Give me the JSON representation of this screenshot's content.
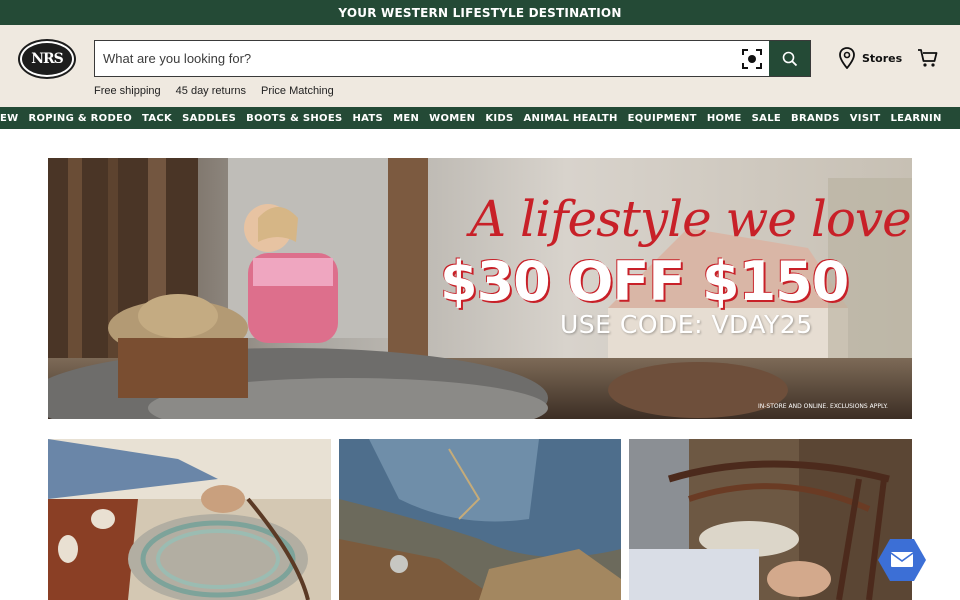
{
  "announcement": "YOUR WESTERN LIFESTYLE DESTINATION",
  "logo": {
    "text": "NRS"
  },
  "search": {
    "placeholder": "What are you looking for?"
  },
  "header": {
    "stores_label": "Stores"
  },
  "perks": [
    "Free shipping",
    "45 day returns",
    "Price Matching"
  ],
  "nav": [
    "EW",
    "ROPING & RODEO",
    "TACK",
    "SADDLES",
    "BOOTS & SHOES",
    "HATS",
    "MEN",
    "WOMEN",
    "KIDS",
    "ANIMAL HEALTH",
    "EQUIPMENT",
    "HOME",
    "SALE",
    "BRANDS",
    "VISIT",
    "LEARNIN"
  ],
  "hero": {
    "script": "A lifestyle we love!",
    "offer": "$30 OFF $150",
    "code": "USE CODE: VDAY25",
    "fine_print": "IN-STORE AND ONLINE. EXCLUSIONS APPLY."
  },
  "colors": {
    "brand_green": "#244a36",
    "header_bg": "#efe9e0",
    "accent_red": "#c82028",
    "chat_blue": "#3c6fd6"
  },
  "icons": [
    "camera-search-icon",
    "search-icon",
    "location-pin-icon",
    "cart-icon",
    "mail-icon"
  ]
}
